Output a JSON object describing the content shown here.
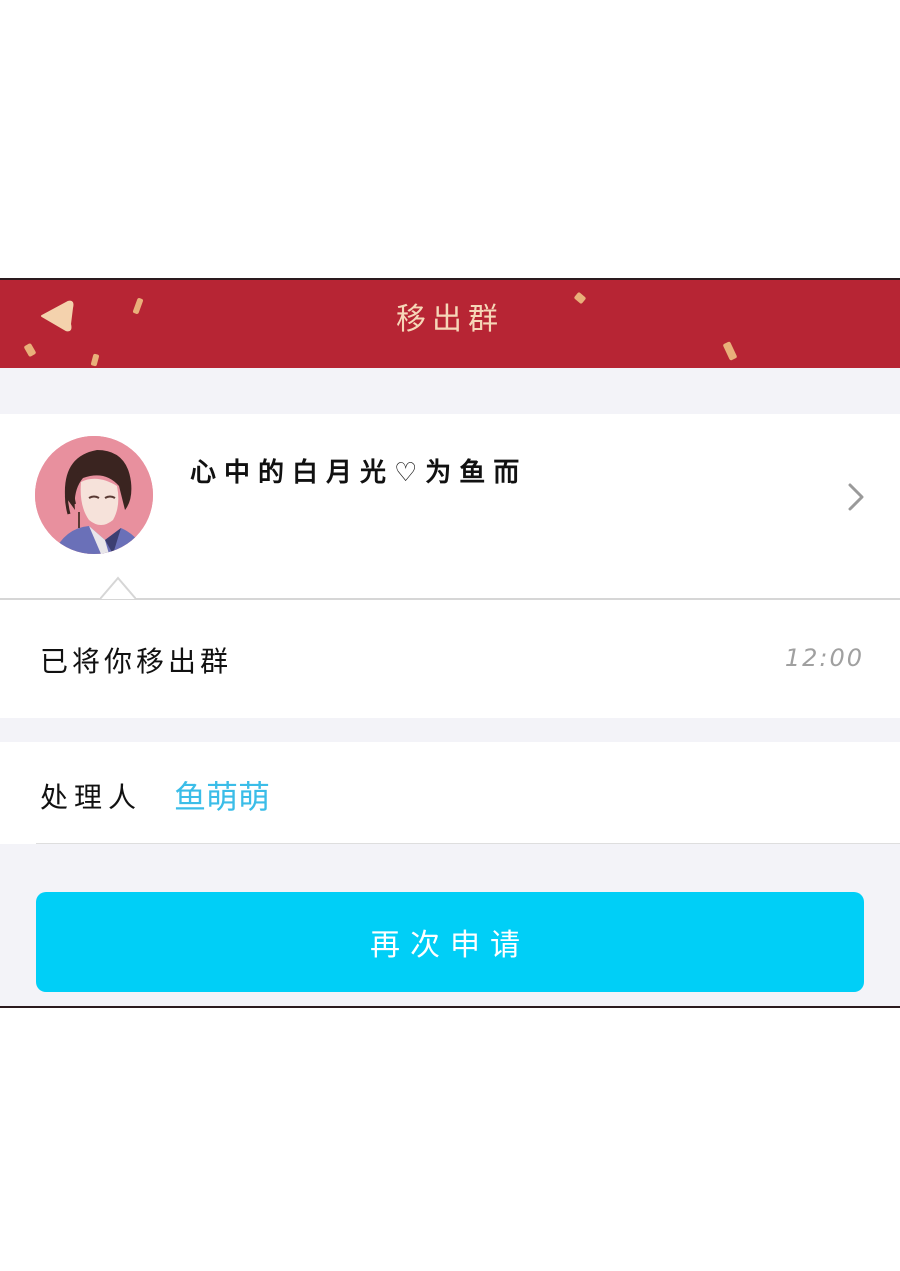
{
  "header": {
    "title": "移出群",
    "back_icon": "back-arrow-icon",
    "background_color": "#b72534",
    "title_color": "#f6d7b8"
  },
  "user": {
    "name": "心中的白月光♡为鱼而",
    "avatar_icon": "user-avatar",
    "chevron_icon": "chevron-right-icon"
  },
  "message": {
    "text": "已将你移出群",
    "time": "12:00"
  },
  "handler": {
    "label": "处理人",
    "name": "鱼萌萌",
    "name_color": "#3bbde8"
  },
  "action": {
    "reapply_label": "再次申请",
    "button_color": "#00cff7"
  }
}
